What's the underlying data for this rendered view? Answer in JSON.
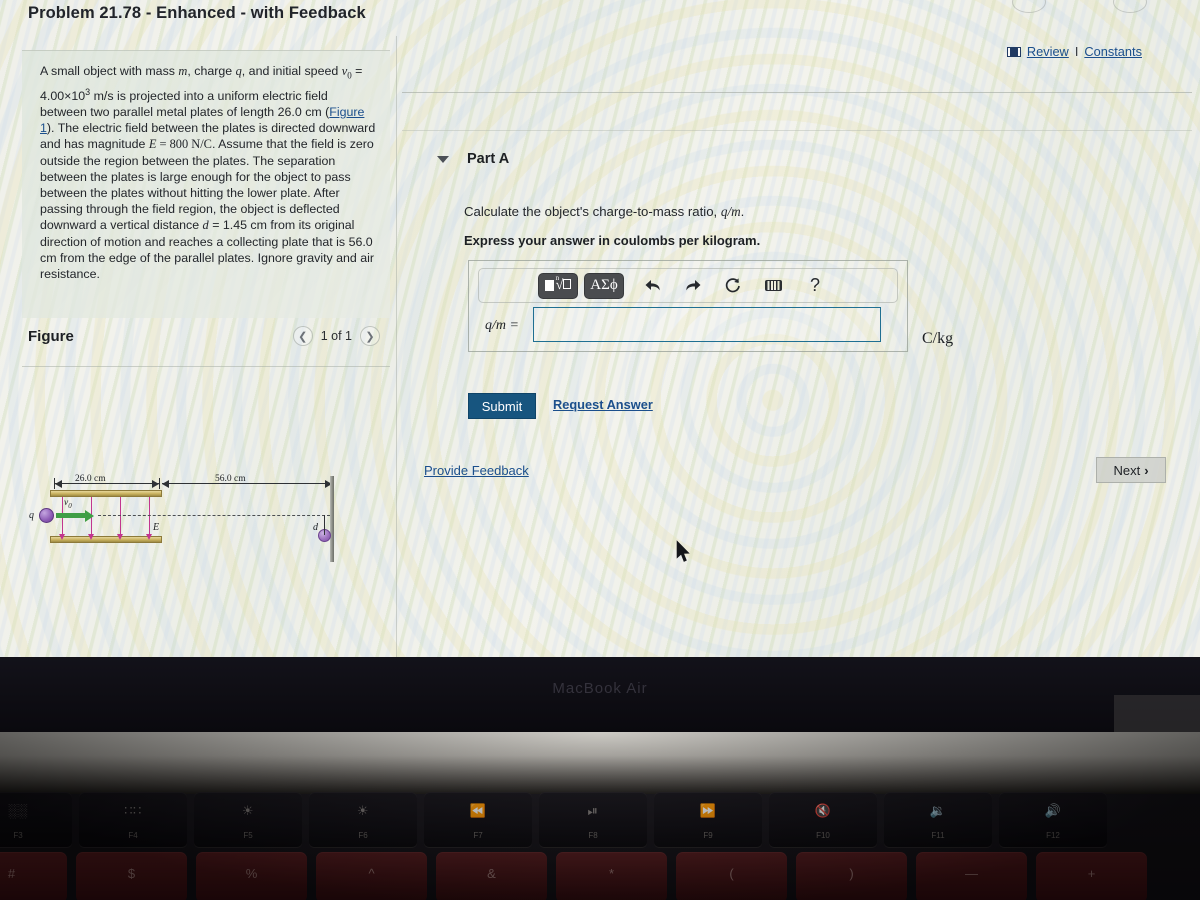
{
  "header": {
    "title": "Problem 21.78 - Enhanced - with Feedback"
  },
  "meta": {
    "book_icon": "book-icon",
    "review_label": "Review",
    "separator": "I",
    "constants_label": "Constants"
  },
  "problem": {
    "paragraph_parts": [
      "A small object with mass ",
      "m",
      ", charge ",
      "q",
      ", and initial speed ",
      "v",
      "0",
      " = 4.00×10",
      "3",
      " m/s is projected into a uniform electric field between two parallel metal plates of length 26.0 cm (",
      "Figure 1",
      "). The electric field between the plates is directed downward and has magnitude ",
      "E",
      " = 800 N/C",
      ". Assume that the field is zero outside the region between the plates. The separation between the plates is large enough for the object to pass between the plates without hitting the lower plate. After passing through the field region, the object is deflected downward a vertical distance ",
      "d",
      " = 1.45 cm from its original direction of motion and reaches a collecting plate that is 56.0 cm from the edge of the parallel plates. Ignore gravity and air resistance."
    ],
    "figure_link_label": "Figure 1"
  },
  "figure": {
    "label": "Figure",
    "prev_icon": "chevron-left-icon",
    "next_icon": "chevron-right-icon",
    "counter": "1 of 1",
    "diagram": {
      "plate_length_label": "26.0 cm",
      "gap_length_label": "56.0 cm",
      "charge_label": "q",
      "velocity_label": "v",
      "velocity_sub": "0",
      "field_label": "E",
      "deflection_label": "d"
    }
  },
  "part": {
    "caret_icon": "caret-down-icon",
    "title": "Part A",
    "question": "Calculate the object's charge-to-mass ratio, ",
    "question_symbol": "q/m",
    "question_end": ".",
    "instruction": "Express your answer in coulombs per kilogram.",
    "answer_label": "q/m =",
    "answer_value": "",
    "answer_placeholder": "",
    "units": "C/kg"
  },
  "mathbar": {
    "sqrt_button": "√",
    "sqrt_index": "n",
    "greek_button": "ΑΣϕ",
    "undo_icon": "undo-arrow-icon",
    "redo_icon": "redo-arrow-icon",
    "reset_icon": "reset-circle-icon",
    "keyboard_icon": "keyboard-icon",
    "help_icon": "question-mark-icon",
    "undo_glyph": "⬅",
    "redo_glyph": "➡",
    "reset_glyph": "↻",
    "help_glyph": "?"
  },
  "actions": {
    "submit_label": "Submit",
    "request_answer_label": "Request Answer",
    "provide_feedback_label": "Provide Feedback",
    "next_label": "Next",
    "next_icon_glyph": "›"
  },
  "laptop": {
    "brand_text": "MacBook Air",
    "function_keys": [
      {
        "glyph": "░░",
        "label": "F3",
        "name": "mission-control-key"
      },
      {
        "glyph": "∷∷",
        "label": "F4",
        "name": "launchpad-key"
      },
      {
        "glyph": "☀",
        "label": "F5",
        "name": "keyboard-brightness-down-key"
      },
      {
        "glyph": "☀",
        "label": "F6",
        "name": "keyboard-brightness-up-key"
      },
      {
        "glyph": "⏪",
        "label": "F7",
        "name": "rewind-key"
      },
      {
        "glyph": "⏯",
        "label": "F8",
        "name": "play-pause-key"
      },
      {
        "glyph": "⏩",
        "label": "F9",
        "name": "fast-forward-key"
      },
      {
        "glyph": "🔇",
        "label": "F10",
        "name": "mute-key"
      },
      {
        "glyph": "🔉",
        "label": "F11",
        "name": "volume-down-key"
      },
      {
        "glyph": "🔊",
        "label": "F12",
        "name": "volume-up-key"
      }
    ],
    "number_keys": [
      {
        "glyph": "#",
        "name": "key-3"
      },
      {
        "glyph": "$",
        "name": "key-4"
      },
      {
        "glyph": "%",
        "name": "key-5"
      },
      {
        "glyph": "^",
        "name": "key-6"
      },
      {
        "glyph": "&",
        "name": "key-7"
      },
      {
        "glyph": "*",
        "name": "key-8"
      },
      {
        "glyph": "(",
        "name": "key-9"
      },
      {
        "glyph": ")",
        "name": "key-0"
      },
      {
        "glyph": "—",
        "name": "key-minus"
      },
      {
        "glyph": "+",
        "name": "key-plus"
      }
    ]
  },
  "colors": {
    "link": "#1b4f8c",
    "submit_bg": "#17557f",
    "input_border": "#1f6f92",
    "plate": "#c9b25f",
    "field_arrow": "#c2368f",
    "velocity_arrow": "#3f9e45",
    "charge": "#8d5bb5"
  }
}
